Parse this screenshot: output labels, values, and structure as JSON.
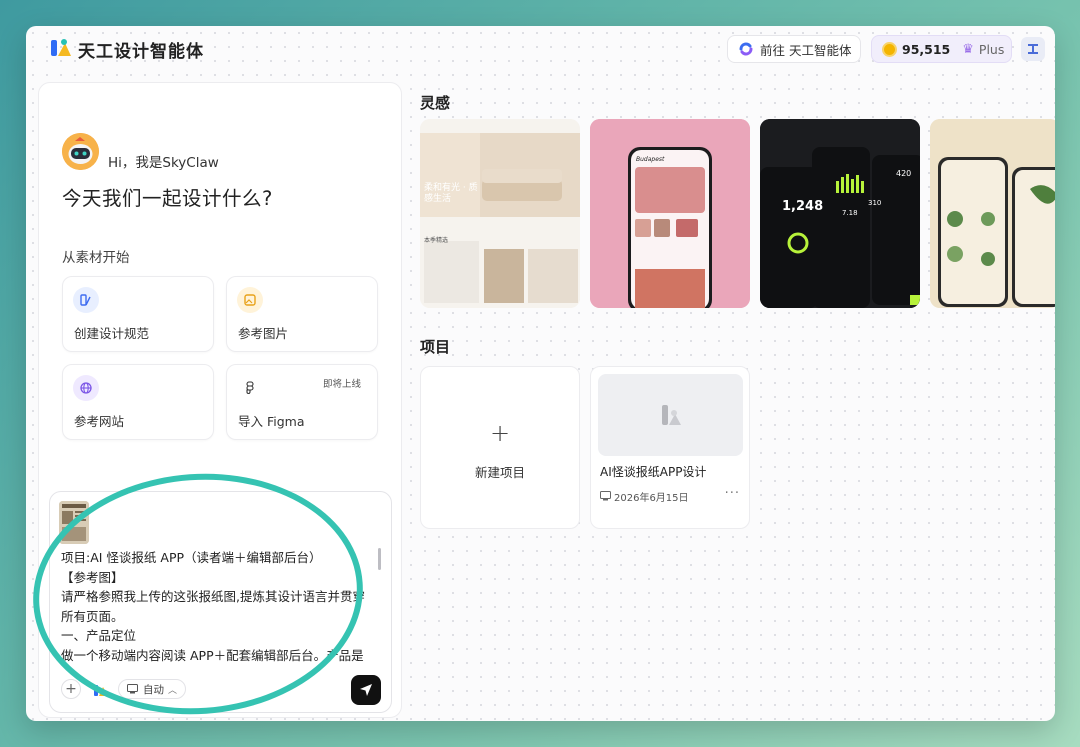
{
  "app": {
    "title": "天工设计智能体"
  },
  "header": {
    "goto_label": "前往 天工智能体",
    "credits": "95,515",
    "plan": "Plus"
  },
  "left": {
    "greeting": "Hi，我是SkyClaw",
    "headline": "今天我们一起设计什么?",
    "start_label": "从素材开始",
    "cards": [
      {
        "label": "创建设计规范",
        "icon": "design-spec-icon"
      },
      {
        "label": "参考图片",
        "icon": "image-icon"
      },
      {
        "label": "参考网站",
        "icon": "globe-icon"
      },
      {
        "label": "导入 Figma",
        "icon": "figma-icon",
        "badge": "即将上线"
      }
    ],
    "input": {
      "lines": [
        "项目:AI 怪谈报纸 APP（读者端＋编辑部后台）",
        "【参考图】",
        "请严格参照我上传的这张报纸图,提炼其设计语言并贯穿",
        "所有页面。",
        "一、产品定位",
        "做一个移动端内容阅读 APP＋配套编辑部后台。产品是"
      ],
      "mode_label": "自动"
    }
  },
  "right": {
    "inspiration_title": "灵感",
    "inspiration_cards": [
      {
        "name": "home-interior-app",
        "banner_text": "柔和有光 · 质感生活",
        "section_text": "本季精选"
      },
      {
        "name": "budapest-travel-app",
        "app_name": "Budapest"
      },
      {
        "name": "fitness-dashboard-app",
        "value1": "1,248",
        "value2": "420",
        "value3": "310",
        "value4": "7.18"
      },
      {
        "name": "plant-care-app"
      }
    ],
    "projects_title": "项目",
    "new_project_label": "新建项目",
    "projects": [
      {
        "name": "AI怪谈报纸APP设计",
        "date": "2026年6月15日"
      }
    ]
  },
  "colors": {
    "accent": "#35c3b2",
    "send": "#111111",
    "plus": "#9a6ee8"
  }
}
